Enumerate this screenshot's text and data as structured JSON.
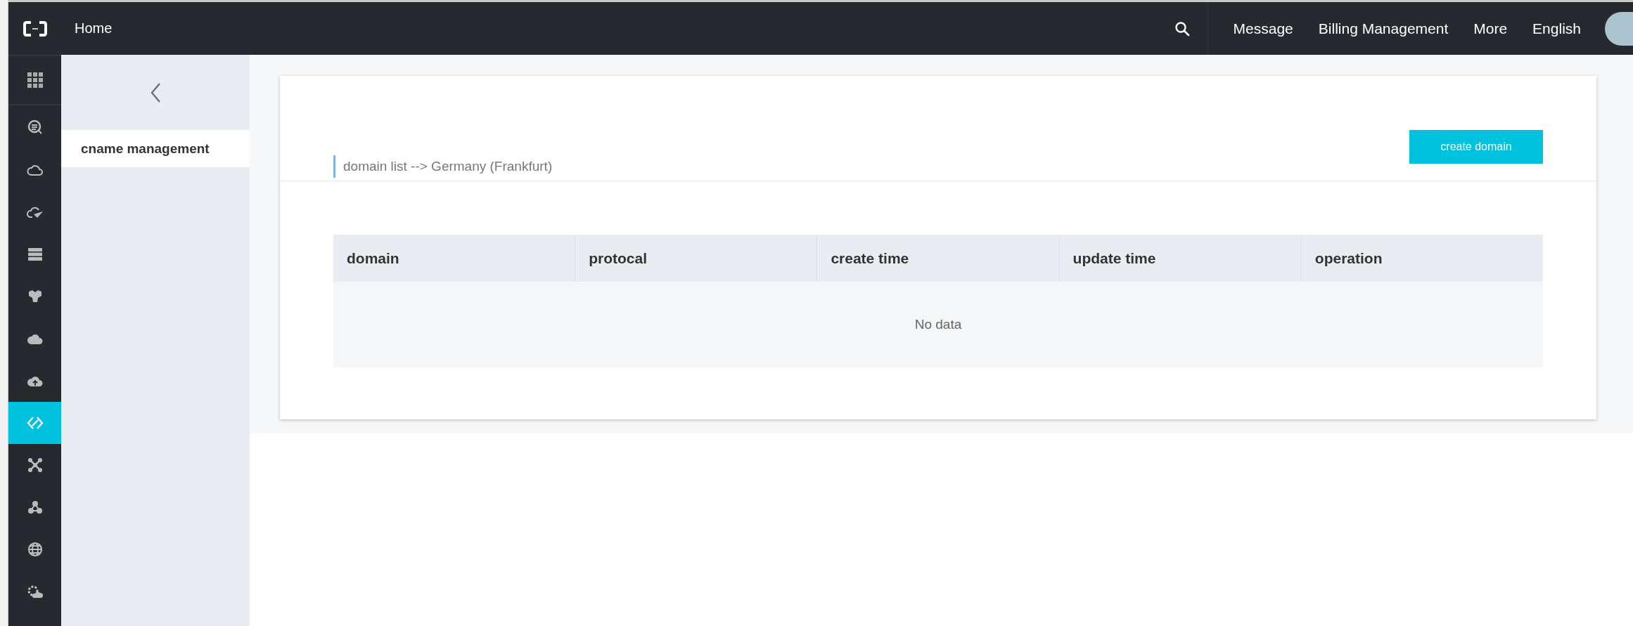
{
  "top_bar": {
    "home": "Home",
    "links": [
      "Message",
      "Billing Management",
      "More",
      "English"
    ]
  },
  "rail": {
    "items": [
      {
        "kind": "search-doc",
        "selected": false
      },
      {
        "kind": "cloud",
        "selected": false
      },
      {
        "kind": "cloud-send",
        "selected": false
      },
      {
        "kind": "server",
        "selected": false
      },
      {
        "kind": "hex",
        "selected": false
      },
      {
        "kind": "cloud-net",
        "selected": false
      },
      {
        "kind": "cloud-up",
        "selected": false
      },
      {
        "kind": "link",
        "selected": true
      },
      {
        "kind": "cross",
        "selected": false
      },
      {
        "kind": "nodes",
        "selected": false
      },
      {
        "kind": "globe",
        "selected": false
      },
      {
        "kind": "gear-cloud",
        "selected": false
      }
    ]
  },
  "side_menu": {
    "items": [
      {
        "label": "cname management",
        "selected": true
      }
    ]
  },
  "panel": {
    "heading": "domain list --> Germany (Frankfurt)",
    "create_button": "create domain",
    "table": {
      "columns": [
        "domain",
        "protocal",
        "create time",
        "update time",
        "operation"
      ],
      "empty_text": "No data"
    }
  }
}
